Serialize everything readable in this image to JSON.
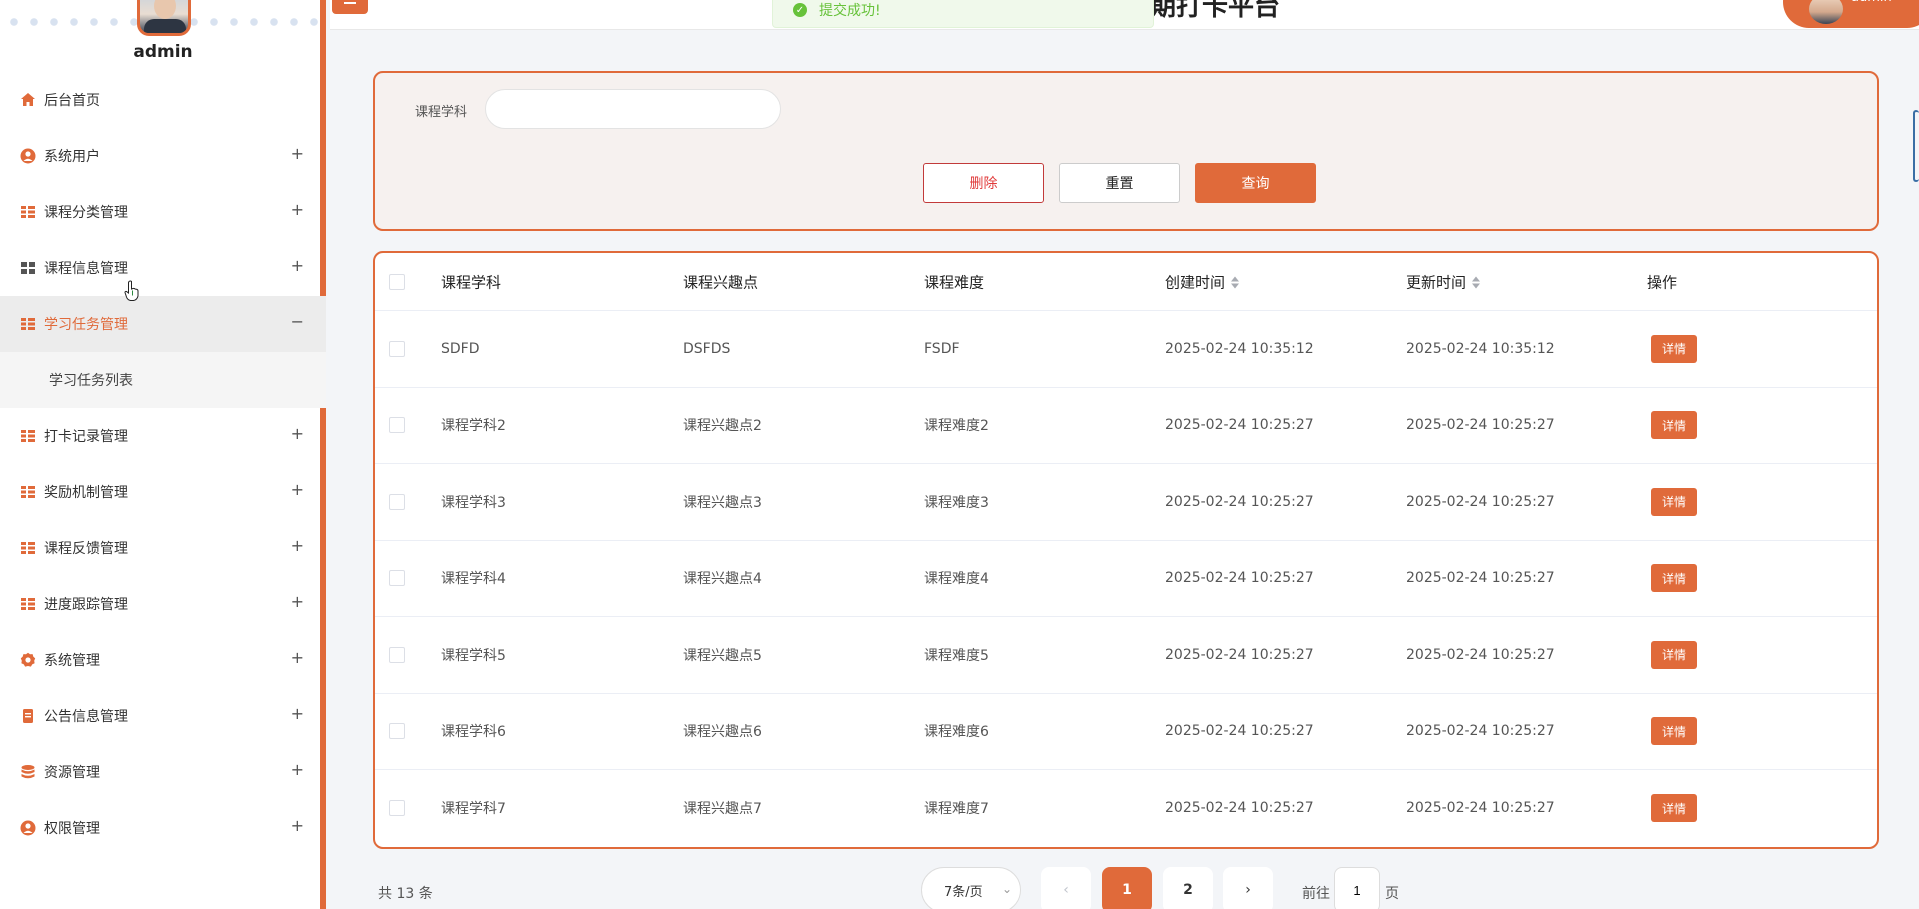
{
  "app": {
    "username": "admin",
    "site_title": "期打卡平台",
    "user_label": "admin"
  },
  "toast": {
    "message": "提交成功!"
  },
  "sidebar": {
    "items": [
      {
        "label": "后台首页",
        "icon": "home-icon"
      },
      {
        "label": "系统用户",
        "icon": "user-icon"
      },
      {
        "label": "课程分类管理",
        "icon": "grid-icon"
      },
      {
        "label": "课程信息管理",
        "icon": "grid-icon"
      },
      {
        "label": "学习任务管理",
        "icon": "grid-icon",
        "expanded": true,
        "children": [
          {
            "label": "学习任务列表"
          }
        ]
      },
      {
        "label": "打卡记录管理",
        "icon": "grid-icon"
      },
      {
        "label": "奖励机制管理",
        "icon": "grid-icon"
      },
      {
        "label": "课程反馈管理",
        "icon": "grid-icon"
      },
      {
        "label": "进度跟踪管理",
        "icon": "grid-icon"
      },
      {
        "label": "系统管理",
        "icon": "gear-icon"
      },
      {
        "label": "公告信息管理",
        "icon": "document-icon"
      },
      {
        "label": "资源管理",
        "icon": "database-icon"
      },
      {
        "label": "权限管理",
        "icon": "user-icon"
      }
    ]
  },
  "search": {
    "label": "课程学科",
    "value": "",
    "delete_label": "删除",
    "reset_label": "重置",
    "query_label": "查询"
  },
  "table": {
    "headers": [
      "课程学科",
      "课程兴趣点",
      "课程难度",
      "创建时间",
      "更新时间",
      "操作"
    ],
    "detail_label": "详情",
    "rows": [
      [
        "SDFD",
        "DSFDS",
        "FSDF",
        "2025-02-24 10:35:12",
        "2025-02-24 10:35:12"
      ],
      [
        "课程学科2",
        "课程兴趣点2",
        "课程难度2",
        "2025-02-24 10:25:27",
        "2025-02-24 10:25:27"
      ],
      [
        "课程学科3",
        "课程兴趣点3",
        "课程难度3",
        "2025-02-24 10:25:27",
        "2025-02-24 10:25:27"
      ],
      [
        "课程学科4",
        "课程兴趣点4",
        "课程难度4",
        "2025-02-24 10:25:27",
        "2025-02-24 10:25:27"
      ],
      [
        "课程学科5",
        "课程兴趣点5",
        "课程难度5",
        "2025-02-24 10:25:27",
        "2025-02-24 10:25:27"
      ],
      [
        "课程学科6",
        "课程兴趣点6",
        "课程难度6",
        "2025-02-24 10:25:27",
        "2025-02-24 10:25:27"
      ],
      [
        "课程学科7",
        "课程兴趣点7",
        "课程难度7",
        "2025-02-24 10:25:27",
        "2025-02-24 10:25:27"
      ]
    ]
  },
  "pagination": {
    "total": "共 13 条",
    "page_size": "7条/页",
    "prev": "‹",
    "next": "›",
    "pages": [
      "1",
      "2"
    ],
    "current_page": 1,
    "goto_label": "前往",
    "goto_value": "1",
    "page_unit": "页"
  },
  "colors": {
    "accent": "#e06a3a",
    "success": "#67c23a",
    "danger": "#e03a3a"
  }
}
